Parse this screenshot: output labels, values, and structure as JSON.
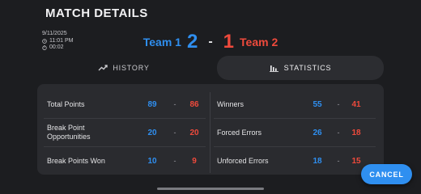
{
  "header": {
    "title": "MATCH DETAILS"
  },
  "meta": {
    "date": "9/11/2025",
    "time": "11:01 PM",
    "duration": "00:02"
  },
  "score": {
    "team1_name": "Team 1",
    "team1_score": "2",
    "separator": "-",
    "team2_score": "1",
    "team2_name": "Team 2"
  },
  "tabs": [
    {
      "label": "HISTORY",
      "active": false
    },
    {
      "label": "STATISTICS",
      "active": true
    }
  ],
  "stats_left": [
    {
      "label": "Total Points",
      "team1": "89",
      "sep": "-",
      "team2": "86"
    },
    {
      "label": "Break Point Opportunities",
      "team1": "20",
      "sep": "-",
      "team2": "20"
    },
    {
      "label": "Break Points Won",
      "team1": "10",
      "sep": "-",
      "team2": "9"
    }
  ],
  "stats_right": [
    {
      "label": "Winners",
      "team1": "55",
      "sep": "-",
      "team2": "41"
    },
    {
      "label": "Forced Errors",
      "team1": "26",
      "sep": "-",
      "team2": "18"
    },
    {
      "label": "Unforced Errors",
      "team1": "18",
      "sep": "-",
      "team2": "15"
    }
  ],
  "actions": {
    "cancel_label": "CANCEL"
  },
  "colors": {
    "team1": "#2f8ff0",
    "team2": "#ef4a3c",
    "background": "#1c1d20",
    "panel": "#2a2b2f"
  }
}
